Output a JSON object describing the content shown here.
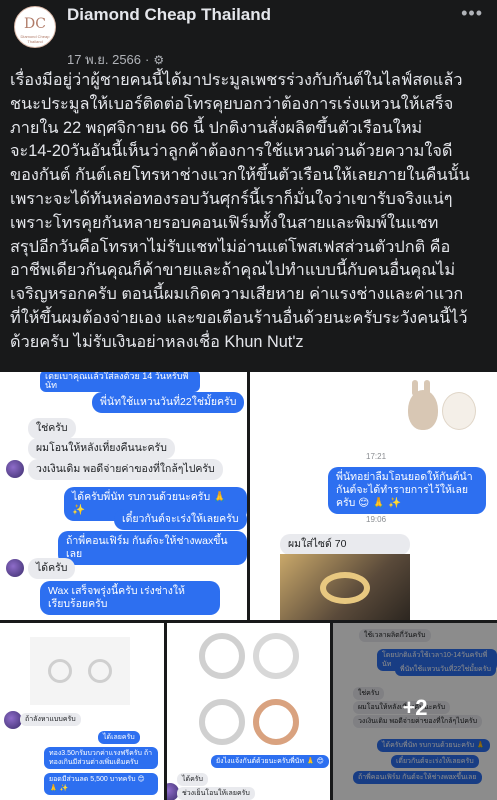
{
  "post": {
    "page_name": "Diamond Cheap Thailand",
    "avatar_monogram": "DC",
    "avatar_caption": "Diamond Cheap Thailand",
    "date": "17 พ.ย. 2566",
    "privacy_icon": "gear-icon",
    "more_icon": "more-icon",
    "body": "เรื่องมีอยู่ว่าผู้ชายคนนี้ได้มาประมูลเพชรร่วงกับกันต์ในไลฟ์สดแล้ว\nชนะประมูลให้เบอร์ติดต่อโทรคุยบอกว่าต้องการเร่งแหวนให้เสร็จ\nภายใน 22 พฤศจิกายน 66 นี้ ปกติงานสั่งผลิตขึ้นตัวเรือนใหม่\nจะ14-20วันอันนี้เห็นว่าลูกค้าต้องการใช้แหวนด่วนด้วยความใจดี\nของกันต์ กันต์เลยโทรหาช่างแวกให้ขึ้นตัวเรือนให้เลยภายในคืนนั้น\nเพราะจะได้ทันหล่อทองรอบวันศุกร์นี้เราก็มั่นใจว่าเขารับจริงแน่ๆ\nเพราะโทรคุยกันหลายรอบคอนเฟิร์มทั้งในสายและพิมพ์ในแชท\nสรุปอีกวันคือโทรหาไม่รับแชทไม่อ่านแต่โพสเฟสส่วนตัวปกติ คือ\nอาชีพเดียวกันคุณก็ค้าขายและถ้าคุณไปทำแบบนี้กับคนอื่นคุณไม่\nเจริญหรอกครับ ตอนนี้ผมเกิดความเสียหาย ค่าแรงช่างและค่าแวก\nที่ให้ขึ้นผมต้องจ่ายเอง และขอเตือนร้านอื่นด้วยนะครับระวังคนนี้ไว้\nด้วยครับ ไม่รับเงินอย่าหลงเชื่อ Khun Nut'z"
  },
  "photos": {
    "chat1": {
      "top_partial": "เตยเบาคุณแล้วใส่ลงด้วย 14 วันหรับพี่นัท",
      "b1": "พี่นัทใช้แหวนวันที่22ใช่มั้ยครับ",
      "g1": "ใช่ครับ",
      "g2": "ผมโอนให้หลังเที่ยงคืนนะครับ",
      "g3": "วงเงินเดิม พอดีจ่ายค่าของที่ใกล้ๆไปครับ",
      "b2": "ได้ครับพี่นัท รบกวนด้วยนะครับ 🙏 ✨",
      "b3": "เดี๋ยวกันต์จะเร่งให้เลยครับ",
      "b4": "ถ้าพี่คอนเฟิร์ม กันต์จะให้ช่างwaxขึ้นเลย",
      "g4": "ได้ครับ",
      "b5": "Wax เสร็จพรุ่งนี้ครับ เร่งช่างให้เรียบร้อยครับ"
    },
    "chat2": {
      "time1": "17:21",
      "b1": "พี่นัทอย่าลืมโอนยอดให้กันต์นำ กันต์จะได้ทำรายการไว้ให้เลยครับ 😊 🙏 ✨",
      "time2": "19:06",
      "g1": "ผมใส่ไซด์ 70"
    },
    "chat3": {
      "g1": "ถ้าลังหาแบบครับ",
      "b1": "ได้เลยครับ",
      "b2": "ทอง3.50กรัมบวกค่าแรงฟรีครับ ถ้าทองเกินมีส่วนต่างเพิ่มเติมครับ",
      "b3": "ยอดมีส่วนลด 5,500 บาทครับ 😊 🙏 ✨"
    },
    "chat4": {
      "b1": "ยังไงแจ้งกันต์ด้วยนะครับพี่นัท 🙏 😊",
      "g1": "ได้ครับ",
      "g2": "ช่วงเย็นโอนให้เลยครับ"
    },
    "chat5": {
      "g1": "ใช้เวลาผลิตกี่วันครับ",
      "b1": "โดยปกติแล้วใช้เวลา10-14วันครับพี่นัท",
      "b2": "พี่นัทใช้แหวนวันที่22ใช่มั้ยครับ",
      "g2": "ใช่ครับ",
      "g3": "ผมโอนให้หลังเที่ยงคืนนะครับ",
      "g4": "วงเงินเดิม พอดีจ่ายค่าของที่ใกล้ๆไปครับ",
      "b3": "ได้ครับพี่นัท รบกวนด้วยนะครับ 🙏",
      "b4": "เดี๋ยวกันต์จะเร่งให้เลยครับ",
      "b5": "ถ้าพี่คอนเฟิร์ม กันต์จะให้ช่างwaxขึ้นเลย",
      "more_count": "+2"
    }
  },
  "colors": {
    "background": "#18191a",
    "text": "#e4e6eb",
    "muted": "#b0b3b8",
    "bubble_blue": "#2d6ff0"
  }
}
